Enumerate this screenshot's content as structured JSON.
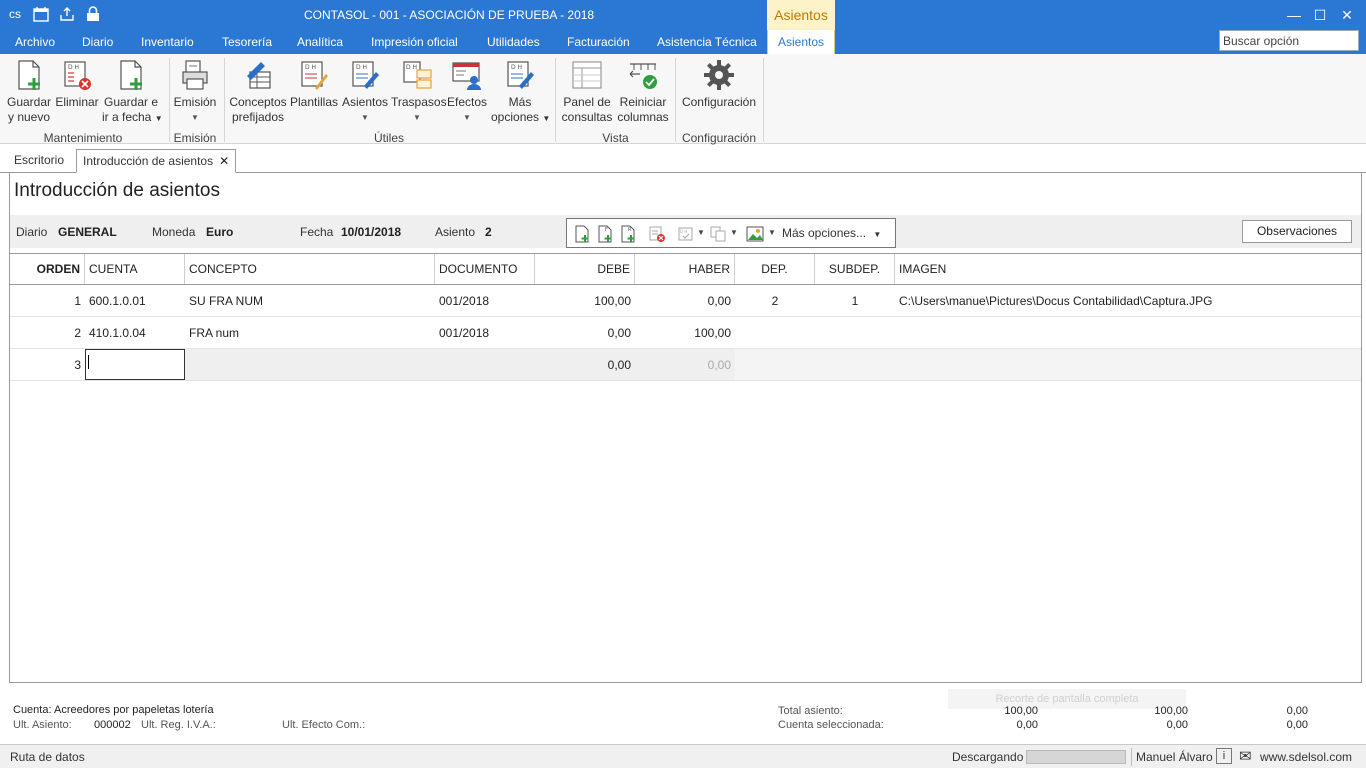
{
  "window": {
    "title": "CONTASOL - 001 - ASOCIACIÓN DE PRUEBA - 2018",
    "context_tab_group": "Asientos",
    "controls": [
      "—",
      "☐",
      "✕"
    ]
  },
  "menu": {
    "tabs": [
      "Archivo",
      "Diario",
      "Inventario",
      "Tesorería",
      "Analítica",
      "Impresión oficial",
      "Utilidades",
      "Facturación",
      "Asistencia Técnica",
      "Asientos"
    ],
    "active_tab": "Asientos",
    "search_placeholder": "Buscar opción"
  },
  "ribbon": {
    "buttons": {
      "guardar_nuevo": [
        "Guardar",
        "y nuevo"
      ],
      "eliminar": [
        "Eliminar"
      ],
      "guardar_fecha": [
        "Guardar e",
        "ir a fecha"
      ],
      "emision": [
        "Emisión"
      ],
      "conceptos": [
        "Conceptos",
        "prefijados"
      ],
      "plantillas": [
        "Plantillas"
      ],
      "asientos": [
        "Asientos"
      ],
      "traspasos": [
        "Traspasos"
      ],
      "efectos": [
        "Efectos"
      ],
      "mas_opciones": [
        "Más",
        "opciones"
      ],
      "panel_consultas": [
        "Panel de",
        "consultas"
      ],
      "reiniciar_columnas": [
        "Reiniciar",
        "columnas"
      ],
      "configuracion": [
        "Configuración"
      ]
    },
    "groups": {
      "mantenimiento": "Mantenimiento",
      "emision": "Emisión",
      "utiles": "Útiles",
      "vista": "Vista",
      "configuracion": "Configuración"
    }
  },
  "doc_tabs": {
    "escritorio": "Escritorio",
    "introduccion": "Introducción de asientos",
    "close": "✕"
  },
  "page": {
    "title": "Introducción de asientos",
    "header": {
      "diario_label": "Diario",
      "diario_value": "GENERAL",
      "moneda_label": "Moneda",
      "moneda_value": "Euro",
      "fecha_label": "Fecha",
      "fecha_value": "10/01/2018",
      "asiento_label": "Asiento",
      "asiento_value": "2"
    },
    "toolbar_more": "Más opciones...",
    "observaciones": "Observaciones"
  },
  "grid": {
    "columns": [
      "ORDEN",
      "CUENTA",
      "CONCEPTO",
      "DOCUMENTO",
      "DEBE",
      "HABER",
      "DEP.",
      "SUBDEP.",
      "IMAGEN"
    ],
    "rows": [
      {
        "orden": "1",
        "cuenta": "600.1.0.01",
        "concepto": "SU FRA NUM",
        "documento": "001/2018",
        "debe": "100,00",
        "haber": "0,00",
        "dep": "2",
        "subdep": "1",
        "imagen": "C:\\Users\\manue\\Pictures\\Docus Contabilidad\\Captura.JPG"
      },
      {
        "orden": "2",
        "cuenta": "410.1.0.04",
        "concepto": "FRA num",
        "documento": "001/2018",
        "debe": "0,00",
        "haber": "100,00",
        "dep": "",
        "subdep": "",
        "imagen": ""
      },
      {
        "orden": "3",
        "cuenta": "",
        "concepto": "",
        "documento": "",
        "debe": "0,00",
        "haber": "0,00",
        "dep": "",
        "subdep": "",
        "imagen": ""
      }
    ]
  },
  "footer": {
    "cuenta": "Cuenta: Acreedores por papeletas lotería",
    "ult_asiento_label": "Ult. Asiento:",
    "ult_asiento_value": "000002",
    "ult_reg_iva_label": "Ult. Reg. I.V.A.:",
    "ult_efecto_label": "Ult. Efecto Com.:",
    "ghost_text": "Recorte de pantalla completa",
    "total_asiento_label": "Total asiento:",
    "total_asiento": [
      "100,00",
      "100,00",
      "0,00"
    ],
    "cuenta_sel_label": "Cuenta seleccionada:",
    "cuenta_sel": [
      "0,00",
      "0,00",
      "0,00"
    ]
  },
  "status": {
    "ruta": "Ruta de datos",
    "descargando": "Descargando",
    "progress": 0,
    "user": "Manuel Álvaro",
    "info_icon": "i",
    "mail_icon": "✉",
    "website": "www.sdelsol.com"
  }
}
